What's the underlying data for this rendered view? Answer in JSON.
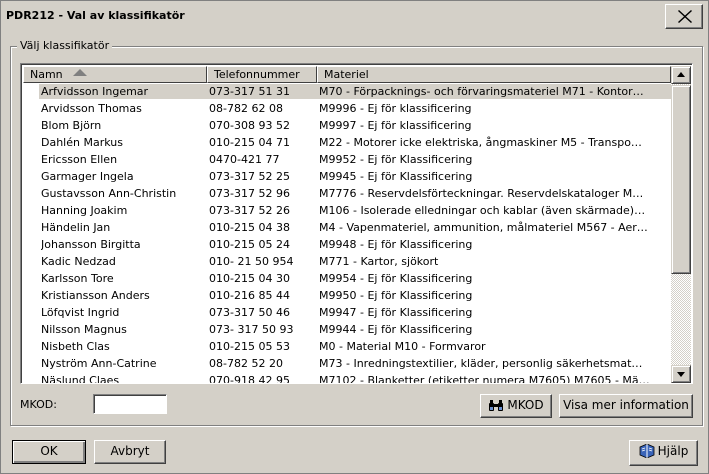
{
  "window": {
    "title": "PDR212 - Val av klassifikatör"
  },
  "group": {
    "legend": "Välj klassifikatör"
  },
  "table": {
    "columns": [
      "Namn",
      "Telefonnummer",
      "Materiel"
    ],
    "sort_column": "Namn",
    "rows": [
      {
        "name": "Arfvidsson Ingemar",
        "tel": "073-317 51 31",
        "mat": "M70 - Förpacknings- och förvaringsmateriel M71 - Kontor…",
        "selected": true
      },
      {
        "name": "Arvidsson Thomas",
        "tel": "08-782 62 08",
        "mat": "M9996 - Ej för klassificering"
      },
      {
        "name": "Blom Björn",
        "tel": "070-308 93 52",
        "mat": "M9997 - Ej för klassificering"
      },
      {
        "name": "Dahlén Markus",
        "tel": "010-215 04 71",
        "mat": "M22 - Motorer icke elektriska, ångmaskiner M5 - Transpo…"
      },
      {
        "name": "Ericsson Ellen",
        "tel": "0470-421 77",
        "mat": "M9952 - Ej för Klassificering"
      },
      {
        "name": "Garmager Ingela",
        "tel": "073-317 52 25",
        "mat": "M9945 - Ej för Klassificering"
      },
      {
        "name": "Gustavsson Ann-Christin",
        "tel": "073-317 52 96",
        "mat": "M7776 - Reservdelsförteckningar. Reservdelskataloger M…"
      },
      {
        "name": "Hanning Joakim",
        "tel": "073-317 52 26",
        "mat": "M106 - Isolerade elledningar och kablar (även skärmade)…"
      },
      {
        "name": "Händelin Jan",
        "tel": "010-215 04 38",
        "mat": "M4 - Vapenmateriel, ammunition, målmateriel M567 - Aer…"
      },
      {
        "name": "Johansson Birgitta",
        "tel": "010-215 05 24",
        "mat": "M9948 - Ej för Klassificering"
      },
      {
        "name": "Kadic Nedzad",
        "tel": "010- 21 50 954",
        "mat": "M771 - Kartor, sjökort"
      },
      {
        "name": "Karlsson Tore",
        "tel": "010-215 04 30",
        "mat": "M9954 - Ej för Klassificering"
      },
      {
        "name": "Kristiansson Anders",
        "tel": "010-216 85 44",
        "mat": "M9950 - Ej för Klassificering"
      },
      {
        "name": "Löfqvist Ingrid",
        "tel": "073-317 50 46",
        "mat": "M9947 - Ej för Klassificering"
      },
      {
        "name": "Nilsson Magnus",
        "tel": "073- 317 50 93",
        "mat": "M9944 - Ej för Klassificering"
      },
      {
        "name": "Nisbeth Clas",
        "tel": "010-215 05 53",
        "mat": "M0 - Material M10 - Formvaror"
      },
      {
        "name": "Nyström Ann-Catrine",
        "tel": "08-782 52 20",
        "mat": "M73 - Inredningstextilier, kläder, personlig säkerhetsmat…"
      },
      {
        "name": "Näslund Claes",
        "tel": "070-918 42 95",
        "mat": "M7102 - Blanketter (etiketter numera M7605) M7605 - Mä…"
      }
    ]
  },
  "mkod": {
    "label": "MKOD:",
    "value": ""
  },
  "buttons": {
    "mkod": "MKOD",
    "more_info": "Visa mer information",
    "ok": "OK",
    "cancel": "Avbryt",
    "help": "Hjälp"
  }
}
